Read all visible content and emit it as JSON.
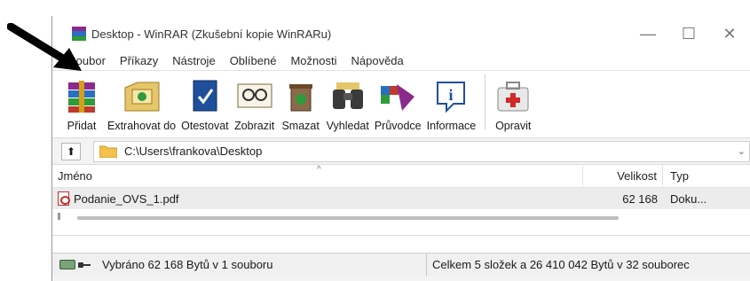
{
  "window": {
    "title": "Desktop - WinRAR (Zkušební kopie WinRARu)",
    "controls": {
      "minimize": "—",
      "maximize": "☐",
      "close": "✕"
    }
  },
  "menu": [
    "Soubor",
    "Příkazy",
    "Nástroje",
    "Oblíbené",
    "Možnosti",
    "Nápověda"
  ],
  "toolbar": [
    {
      "label": "Přidat",
      "icon": "add-archive-icon"
    },
    {
      "label": "Extrahovat do",
      "icon": "extract-icon"
    },
    {
      "label": "Otestovat",
      "icon": "test-icon"
    },
    {
      "label": "Zobrazit",
      "icon": "view-icon"
    },
    {
      "label": "Smazat",
      "icon": "delete-icon"
    },
    {
      "label": "Vyhledat",
      "icon": "find-icon"
    },
    {
      "label": "Průvodce",
      "icon": "wizard-icon"
    },
    {
      "label": "Informace",
      "icon": "info-icon"
    },
    {
      "label": "Opravit",
      "icon": "repair-icon"
    }
  ],
  "address": {
    "up_label": "⬆",
    "path": "C:\\Users\\frankova\\Desktop"
  },
  "columns": {
    "name": "Jméno",
    "size": "Velikost",
    "type": "Typ"
  },
  "files": [
    {
      "name": "Podanie_OVS_1.pdf",
      "size": "62 168",
      "type": "Doku..."
    }
  ],
  "status": {
    "left": "Vybráno 62 168 Bytů v 1 souboru",
    "right": "Celkem 5 složek a 26 410 042 Bytů v 32 souborec"
  },
  "colors": {
    "annotation_arrow": "#000000",
    "window_bg": "#f3f3f3",
    "selected_row": "#ececec"
  }
}
